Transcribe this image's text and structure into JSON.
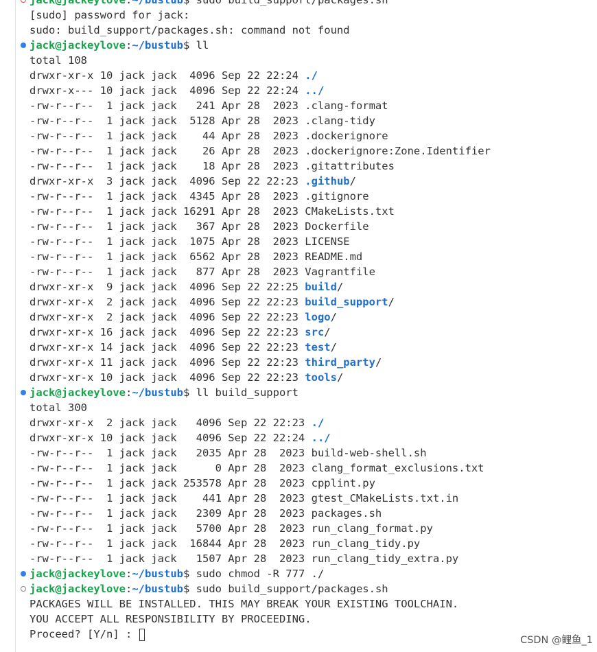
{
  "terminal": {
    "prompt": {
      "user": "jack@jackeylove",
      "path": "~/bustub"
    },
    "lines": [
      {
        "type": "prompt",
        "marker": "red",
        "cmd": "sudo build_support/packages.sh"
      },
      {
        "type": "text",
        "text": "[sudo] password for jack:"
      },
      {
        "type": "text",
        "text": "sudo: build_support/packages.sh: command not found"
      },
      {
        "type": "prompt",
        "marker": "blue",
        "cmd": "ll"
      },
      {
        "type": "text",
        "text": "total 108"
      },
      {
        "type": "ls",
        "meta": "drwxr-xr-x 10 jack jack  4096 Sep 22 22:24 ",
        "name": "./",
        "dir": true
      },
      {
        "type": "ls",
        "meta": "drwxr-x--- 10 jack jack  4096 Sep 22 22:24 ",
        "name": "../",
        "dir": true
      },
      {
        "type": "ls",
        "meta": "-rw-r--r--  1 jack jack   241 Apr 28  2023 ",
        "name": ".clang-format"
      },
      {
        "type": "ls",
        "meta": "-rw-r--r--  1 jack jack  5128 Apr 28  2023 ",
        "name": ".clang-tidy"
      },
      {
        "type": "ls",
        "meta": "-rw-r--r--  1 jack jack    44 Apr 28  2023 ",
        "name": ".dockerignore"
      },
      {
        "type": "ls",
        "meta": "-rw-r--r--  1 jack jack    26 Apr 28  2023 ",
        "name": ".dockerignore:Zone.Identifier"
      },
      {
        "type": "ls",
        "meta": "-rw-r--r--  1 jack jack    18 Apr 28  2023 ",
        "name": ".gitattributes"
      },
      {
        "type": "ls",
        "meta": "drwxr-xr-x  3 jack jack  4096 Sep 22 22:23 ",
        "name": ".github",
        "dir": true
      },
      {
        "type": "ls",
        "meta": "-rw-r--r--  1 jack jack  4345 Apr 28  2023 ",
        "name": ".gitignore"
      },
      {
        "type": "ls",
        "meta": "-rw-r--r--  1 jack jack 16291 Apr 28  2023 ",
        "name": "CMakeLists.txt"
      },
      {
        "type": "ls",
        "meta": "-rw-r--r--  1 jack jack   367 Apr 28  2023 ",
        "name": "Dockerfile"
      },
      {
        "type": "ls",
        "meta": "-rw-r--r--  1 jack jack  1075 Apr 28  2023 ",
        "name": "LICENSE"
      },
      {
        "type": "ls",
        "meta": "-rw-r--r--  1 jack jack  6562 Apr 28  2023 ",
        "name": "README.md"
      },
      {
        "type": "ls",
        "meta": "-rw-r--r--  1 jack jack   877 Apr 28  2023 ",
        "name": "Vagrantfile"
      },
      {
        "type": "ls",
        "meta": "drwxr-xr-x  9 jack jack  4096 Sep 22 22:25 ",
        "name": "build",
        "dir": true
      },
      {
        "type": "ls",
        "meta": "drwxr-xr-x  2 jack jack  4096 Sep 22 22:23 ",
        "name": "build_support",
        "dir": true
      },
      {
        "type": "ls",
        "meta": "drwxr-xr-x  2 jack jack  4096 Sep 22 22:23 ",
        "name": "logo",
        "dir": true
      },
      {
        "type": "ls",
        "meta": "drwxr-xr-x 16 jack jack  4096 Sep 22 22:23 ",
        "name": "src",
        "dir": true
      },
      {
        "type": "ls",
        "meta": "drwxr-xr-x 14 jack jack  4096 Sep 22 22:23 ",
        "name": "test",
        "dir": true
      },
      {
        "type": "ls",
        "meta": "drwxr-xr-x 11 jack jack  4096 Sep 22 22:23 ",
        "name": "third_party",
        "dir": true
      },
      {
        "type": "ls",
        "meta": "drwxr-xr-x 10 jack jack  4096 Sep 22 22:23 ",
        "name": "tools",
        "dir": true
      },
      {
        "type": "prompt",
        "marker": "blue",
        "cmd": "ll build_support"
      },
      {
        "type": "text",
        "text": "total 300"
      },
      {
        "type": "ls",
        "meta": "drwxr-xr-x  2 jack jack   4096 Sep 22 22:23 ",
        "name": "./",
        "dir": true
      },
      {
        "type": "ls",
        "meta": "drwxr-xr-x 10 jack jack   4096 Sep 22 22:24 ",
        "name": "../",
        "dir": true
      },
      {
        "type": "ls",
        "meta": "-rw-r--r--  1 jack jack   2035 Apr 28  2023 ",
        "name": "build-web-shell.sh"
      },
      {
        "type": "ls",
        "meta": "-rw-r--r--  1 jack jack      0 Apr 28  2023 ",
        "name": "clang_format_exclusions.txt"
      },
      {
        "type": "ls",
        "meta": "-rw-r--r--  1 jack jack 253578 Apr 28  2023 ",
        "name": "cpplint.py"
      },
      {
        "type": "ls",
        "meta": "-rw-r--r--  1 jack jack    441 Apr 28  2023 ",
        "name": "gtest_CMakeLists.txt.in"
      },
      {
        "type": "ls",
        "meta": "-rw-r--r--  1 jack jack   2309 Apr 28  2023 ",
        "name": "packages.sh"
      },
      {
        "type": "ls",
        "meta": "-rw-r--r--  1 jack jack   5700 Apr 28  2023 ",
        "name": "run_clang_format.py"
      },
      {
        "type": "ls",
        "meta": "-rw-r--r--  1 jack jack  16844 Apr 28  2023 ",
        "name": "run_clang_tidy.py"
      },
      {
        "type": "ls",
        "meta": "-rw-r--r--  1 jack jack   1507 Apr 28  2023 ",
        "name": "run_clang_tidy_extra.py"
      },
      {
        "type": "prompt",
        "marker": "blue",
        "cmd": "sudo chmod -R 777 ./"
      },
      {
        "type": "prompt",
        "marker": "hollow",
        "cmd": "sudo build_support/packages.sh"
      },
      {
        "type": "text",
        "text": "PACKAGES WILL BE INSTALLED. THIS MAY BREAK YOUR EXISTING TOOLCHAIN."
      },
      {
        "type": "text",
        "text": "YOU ACCEPT ALL RESPONSIBILITY BY PROCEEDING."
      },
      {
        "type": "input",
        "text": "Proceed? [Y/n] : "
      }
    ]
  },
  "watermark": "CSDN @鲤鱼_1",
  "colors": {
    "user": "#16a34a",
    "path": "#1d6fd1",
    "dir": "#1d6fd1",
    "text": "#333333"
  }
}
